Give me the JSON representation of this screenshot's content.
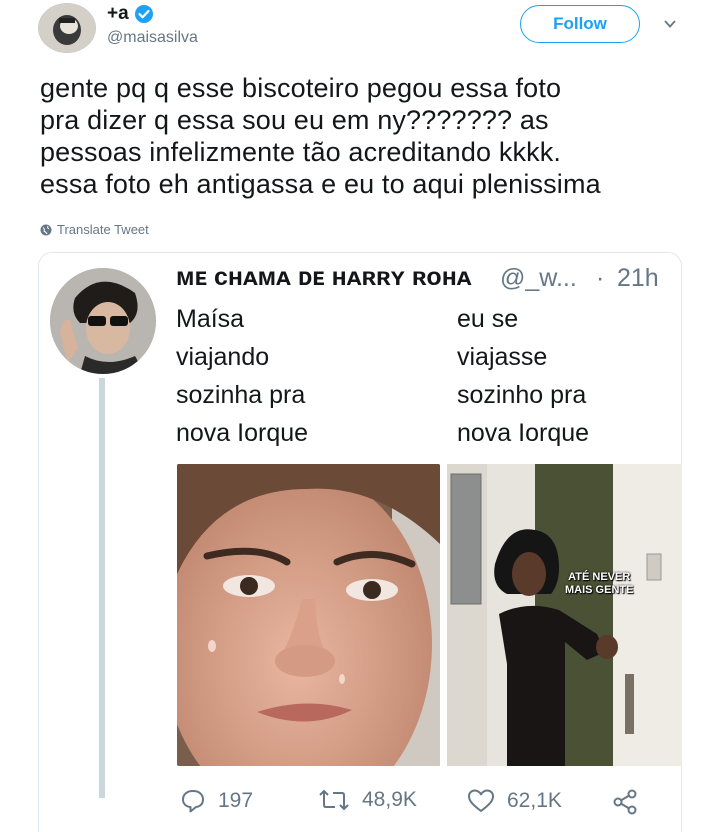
{
  "header": {
    "display_name": "+a",
    "handle": "@maisasilva",
    "follow_label": "Follow"
  },
  "tweet": {
    "lines": [
      "gente pq q esse biscoteiro pegou essa foto",
      "pra dizer q essa sou eu em ny??????? as",
      "pessoas infelizmente tão acreditando kkkk.",
      "essa foto eh antigassa e eu to aqui plenissima"
    ],
    "translate_label": "Translate Tweet"
  },
  "quoted": {
    "display_name": "ᴍᴇ ᴄнᴀᴍᴀ ᴅᴇ нᴀʀʀʏ ʀᴏнᴀ",
    "handle": "@_w...",
    "separator": "·",
    "time": "21h",
    "left_caption": [
      "Maísa",
      "viajando",
      "sozinha pra",
      "nova Iorque"
    ],
    "right_caption": [
      "eu se",
      "viajasse",
      "sozinho pra",
      "nova Iorque"
    ],
    "image_caption_lines": [
      "ATÉ NEVER",
      "MAIS GENTE"
    ]
  },
  "actions": {
    "replies": "197",
    "retweets": "48,9K",
    "likes": "62,1K"
  },
  "colors": {
    "accent": "#1da1f2",
    "muted": "#657786",
    "text": "#14171a",
    "border": "#e1e8ed"
  }
}
